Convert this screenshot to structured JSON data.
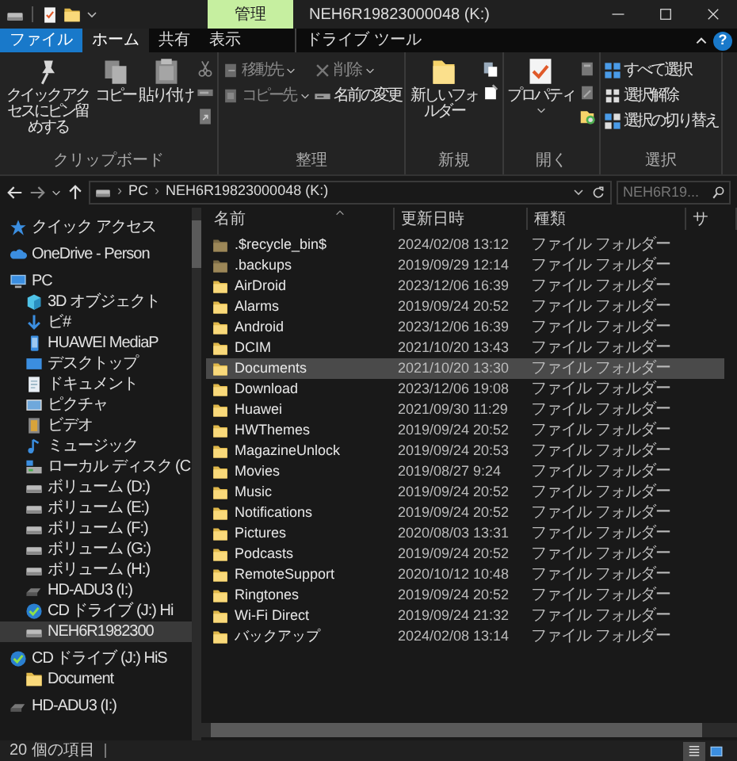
{
  "title_bar": {
    "context_tab": "管理",
    "title": "NEH6R19823000048 (K:)"
  },
  "ribbon_tabs": [
    {
      "label": "ファイル",
      "kind": "file",
      "selected": false
    },
    {
      "label": "ホーム",
      "kind": "tab",
      "selected": true
    },
    {
      "label": "共有",
      "kind": "tab",
      "selected": false
    },
    {
      "label": "表示",
      "kind": "tab",
      "selected": false
    },
    {
      "label": "ドライブ ツール",
      "kind": "context",
      "selected": false
    }
  ],
  "help_button": "?",
  "ribbon_groups": [
    {
      "label": "クリップボード",
      "columns": [
        {
          "kind": "large",
          "label": "クイック アクセスにピン留めする"
        },
        {
          "kind": "large",
          "label": "コピー"
        },
        {
          "kind": "large",
          "label": "貼り付け"
        },
        {
          "kind": "icons"
        }
      ]
    },
    {
      "label": "整理",
      "columns": [
        {
          "kind": "small",
          "items": [
            {
              "label": "移動先",
              "dropdown": true,
              "disabled": true
            },
            {
              "label": "コピー先",
              "dropdown": true,
              "disabled": true
            }
          ]
        },
        {
          "kind": "small",
          "items": [
            {
              "label": "削除",
              "dropdown": true,
              "disabled": true
            },
            {
              "label": "名前の変更",
              "dropdown": false,
              "disabled": false
            }
          ]
        }
      ]
    },
    {
      "label": "新規",
      "columns": [
        {
          "kind": "large",
          "label": "新しいフォルダー"
        },
        {
          "kind": "icons"
        }
      ]
    },
    {
      "label": "開く",
      "columns": [
        {
          "kind": "large",
          "label": "プロパティ",
          "dropdown": true
        },
        {
          "kind": "icons"
        }
      ]
    },
    {
      "label": "選択",
      "columns": [
        {
          "kind": "small",
          "items": [
            {
              "label": "すべて選択",
              "dropdown": false,
              "disabled": false
            },
            {
              "label": "選択解除",
              "dropdown": false,
              "disabled": false
            },
            {
              "label": "選択の切り替え",
              "dropdown": false,
              "disabled": false
            }
          ]
        }
      ]
    }
  ],
  "address_bar": {
    "path": [
      {
        "separator": "›",
        "label": "PC"
      },
      {
        "separator": "›",
        "label": "NEH6R19823000048 (K:)"
      }
    ],
    "search": {
      "placeholder": "NEH6R19..."
    }
  },
  "sidebar": [
    {
      "label": "クイック アクセス",
      "kind": "star",
      "selected": false
    },
    {
      "label": "OneDrive - Person",
      "kind": "cloud",
      "selected": false
    },
    {
      "label": "PC",
      "kind": "pc",
      "selected": false,
      "children": [
        {
          "label": "3D オブジェクト",
          "kind": "cube",
          "selected": false
        },
        {
          "label": "ビ#",
          "kind": "download",
          "selected": false
        },
        {
          "label": "HUAWEI MediaP",
          "kind": "phone",
          "selected": false
        },
        {
          "label": "デスクトップ",
          "kind": "desktop",
          "selected": false
        },
        {
          "label": "ドキュメント",
          "kind": "document",
          "selected": false
        },
        {
          "label": "ピクチャ",
          "kind": "picture",
          "selected": false
        },
        {
          "label": "ビデオ",
          "kind": "video",
          "selected": false
        },
        {
          "label": "ミュージック",
          "kind": "music",
          "selected": false
        },
        {
          "label": "ローカル ディスク (C",
          "kind": "system",
          "selected": false
        },
        {
          "label": "ボリューム (D:)",
          "kind": "drive",
          "selected": false
        },
        {
          "label": "ボリューム (E:)",
          "kind": "drive",
          "selected": false
        },
        {
          "label": "ボリューム (F:)",
          "kind": "drive",
          "selected": false
        },
        {
          "label": "ボリューム (G:)",
          "kind": "drive",
          "selected": false
        },
        {
          "label": "ボリューム (H:)",
          "kind": "drive",
          "selected": false
        },
        {
          "label": "HD-ADU3 (I:)",
          "kind": "usb",
          "selected": false
        },
        {
          "label": "CD ドライブ (J:) Hi",
          "kind": "cd",
          "selected": false
        },
        {
          "label": "NEH6R1982300",
          "kind": "drive",
          "selected": true
        }
      ]
    },
    {
      "label": "CD ドライブ (J:) HiS",
      "kind": "cd",
      "selected": false,
      "children": [
        {
          "label": "Document",
          "kind": "folder",
          "selected": false
        }
      ]
    },
    {
      "label": "HD-ADU3 (I:)",
      "kind": "usb",
      "selected": false
    }
  ],
  "columns": [
    "名前",
    "更新日時",
    "種類",
    "サ"
  ],
  "rows": [
    {
      "name": ".$recycle_bin$",
      "date": "2024/02/08 13:12",
      "type": "ファイル フォルダー",
      "hidden": true,
      "selected": false
    },
    {
      "name": ".backups",
      "date": "2019/09/29 12:14",
      "type": "ファイル フォルダー",
      "hidden": true,
      "selected": false
    },
    {
      "name": "AirDroid",
      "date": "2023/12/06 16:39",
      "type": "ファイル フォルダー",
      "hidden": false,
      "selected": false
    },
    {
      "name": "Alarms",
      "date": "2019/09/24 20:52",
      "type": "ファイル フォルダー",
      "hidden": false,
      "selected": false
    },
    {
      "name": "Android",
      "date": "2023/12/06 16:39",
      "type": "ファイル フォルダー",
      "hidden": false,
      "selected": false
    },
    {
      "name": "DCIM",
      "date": "2021/10/20 13:43",
      "type": "ファイル フォルダー",
      "hidden": false,
      "selected": false
    },
    {
      "name": "Documents",
      "date": "2021/10/20 13:30",
      "type": "ファイル フォルダー",
      "hidden": false,
      "selected": true
    },
    {
      "name": "Download",
      "date": "2023/12/06 19:08",
      "type": "ファイル フォルダー",
      "hidden": false,
      "selected": false
    },
    {
      "name": "Huawei",
      "date": "2021/09/30 11:29",
      "type": "ファイル フォルダー",
      "hidden": false,
      "selected": false
    },
    {
      "name": "HWThemes",
      "date": "2019/09/24 20:52",
      "type": "ファイル フォルダー",
      "hidden": false,
      "selected": false
    },
    {
      "name": "MagazineUnlock",
      "date": "2019/09/24 20:53",
      "type": "ファイル フォルダー",
      "hidden": false,
      "selected": false
    },
    {
      "name": "Movies",
      "date": "2019/08/27 9:24",
      "type": "ファイル フォルダー",
      "hidden": false,
      "selected": false
    },
    {
      "name": "Music",
      "date": "2019/09/24 20:52",
      "type": "ファイル フォルダー",
      "hidden": false,
      "selected": false
    },
    {
      "name": "Notifications",
      "date": "2019/09/24 20:52",
      "type": "ファイル フォルダー",
      "hidden": false,
      "selected": false
    },
    {
      "name": "Pictures",
      "date": "2020/08/03 13:31",
      "type": "ファイル フォルダー",
      "hidden": false,
      "selected": false
    },
    {
      "name": "Podcasts",
      "date": "2019/09/24 20:52",
      "type": "ファイル フォルダー",
      "hidden": false,
      "selected": false
    },
    {
      "name": "RemoteSupport",
      "date": "2020/10/12 10:48",
      "type": "ファイル フォルダー",
      "hidden": false,
      "selected": false
    },
    {
      "name": "Ringtones",
      "date": "2019/09/24 20:52",
      "type": "ファイル フォルダー",
      "hidden": false,
      "selected": false
    },
    {
      "name": "Wi-Fi Direct",
      "date": "2019/09/24 21:32",
      "type": "ファイル フォルダー",
      "hidden": false,
      "selected": false
    },
    {
      "name": "バックアップ",
      "date": "2024/02/08 13:14",
      "type": "ファイル フォルダー",
      "hidden": false,
      "selected": false
    }
  ],
  "status_bar": {
    "count": "20 個の項目",
    "views": [
      {
        "kind": "details",
        "selected": true
      },
      {
        "kind": "tiles",
        "selected": false
      }
    ]
  }
}
